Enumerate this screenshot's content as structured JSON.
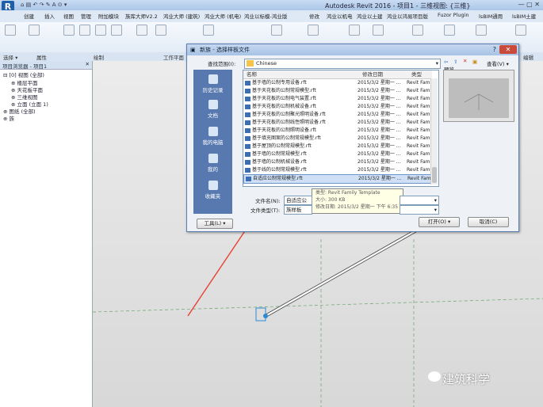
{
  "app": {
    "title": "Autodesk Revit 2016 -  项目1 - 三维视图: {三维}"
  },
  "menu": [
    "创建",
    "插入",
    "视图",
    "管理",
    "附加模块",
    "族库大师V2.2",
    "鸿业大师 (建筑)",
    "鸿业大师 (机电)",
    "鸿业以标模-鸿业版",
    "修改",
    "鸿业以机电",
    "鸿业以土建",
    "鸿业以鸿易项目版",
    "Fuzor Plugin",
    "lsBIM通用",
    "lsBIM土建"
  ],
  "panels": {
    "select": "选择 ▾",
    "properties": "属性",
    "draw": "绘制",
    "workplane": "工作平面",
    "edit": "编辑"
  },
  "project_browser": {
    "header": "项目浏览器 - 项目1",
    "items": [
      "⊟ [0] 视图 (全部)",
      "⊕ 楼层平面",
      "⊕ 天花板平面",
      "⊕ 三维视图",
      "⊕ 立面 (立面 1)",
      "⊕ 图纸 (全部)",
      "⊕ 族"
    ]
  },
  "dialog": {
    "title": "新族 - 选择样板文件",
    "look_in_label": "查找范围(I):",
    "look_in_value": "Chinese",
    "view_menu": "查看(V) ▾",
    "preview_label": "预览",
    "places": [
      "历史记录",
      "文档",
      "我的电脑",
      "我的",
      "收藏夹"
    ],
    "columns": {
      "name": "名称",
      "date": "修改日期",
      "type": "类型"
    },
    "files": [
      {
        "name": "基于墙的公制专用设备.rft",
        "date": "2015/3/2 星期一 ...",
        "type": "Revit Fami"
      },
      {
        "name": "基于天花板的公制常规模型.rft",
        "date": "2015/3/2 星期一 ...",
        "type": "Revit Fami"
      },
      {
        "name": "基于天花板的公制电气装置.rft",
        "date": "2015/3/2 星期一 ...",
        "type": "Revit Fami"
      },
      {
        "name": "基于天花板的公制机械设备.rft",
        "date": "2015/3/2 星期一 ...",
        "type": "Revit Fami"
      },
      {
        "name": "基于天花板的公制聚光照明设备.rft",
        "date": "2015/3/2 星期一 ...",
        "type": "Revit Fami"
      },
      {
        "name": "基于天花板的公制线性照明设备.rft",
        "date": "2015/3/2 星期一 ...",
        "type": "Revit Fami"
      },
      {
        "name": "基于天花板的公制照明设备.rft",
        "date": "2015/3/2 星期一 ...",
        "type": "Revit Fami"
      },
      {
        "name": "基于填充图案的公制常规模型.rft",
        "date": "2015/3/2 星期一 ...",
        "type": "Revit Fami"
      },
      {
        "name": "基于屋顶的公制常规模型.rft",
        "date": "2015/3/2 星期一 ...",
        "type": "Revit Fami"
      },
      {
        "name": "基于墙的公制常规模型.rft",
        "date": "2015/3/2 星期一 ...",
        "type": "Revit Fami"
      },
      {
        "name": "基于墙的公制机械设备.rft",
        "date": "2015/3/2 星期一 ...",
        "type": "Revit Fami"
      },
      {
        "name": "基于线的公制常规模型.rft",
        "date": "2015/3/2 星期一 ...",
        "type": "Revit Fami"
      },
      {
        "name": "自适应公制常规模型.rft",
        "date": "2015/3/2 星期一 ...",
        "type": "Revit Fami"
      }
    ],
    "filename_label": "文件名(N):",
    "filename_value": "自适应公",
    "filetype_label": "文件类型(T):",
    "filetype_value": "族样板",
    "tooltip": [
      "类型: Revit Family Template",
      "大小: 300 KB",
      "修改日期: 2015/3/2 星期一 下午 6:35"
    ],
    "tools_button": "工具(L) ▾",
    "open_button": "打开(O) ▾",
    "cancel_button": "取消(C)"
  },
  "watermark": "建筑科学",
  "colors": {
    "arrow": "#e8412f",
    "dialog_border": "#5a7fb0",
    "places_bg": "#5879b0"
  }
}
